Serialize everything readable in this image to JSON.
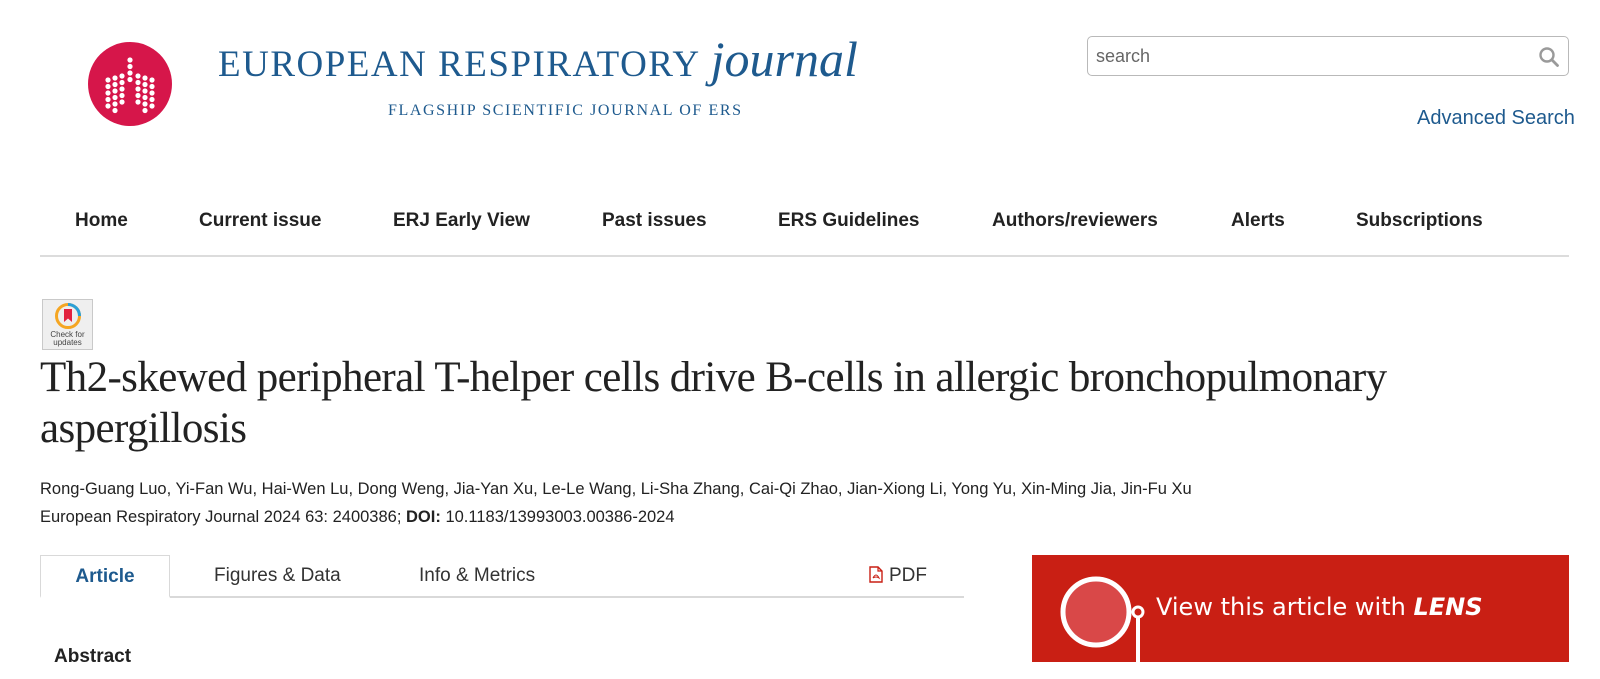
{
  "header": {
    "brand_main": "EUROPEAN RESPIRATORY",
    "brand_italic": "journal",
    "tagline": "FLAGSHIP SCIENTIFIC JOURNAL OF ERS",
    "logo_color": "#d6164a",
    "brand_color": "#1e5a8e",
    "search": {
      "placeholder": "search",
      "value": ""
    },
    "advanced_search": "Advanced Search"
  },
  "nav": {
    "items": [
      {
        "label": "Home"
      },
      {
        "label": "Current issue"
      },
      {
        "label": "ERJ Early View"
      },
      {
        "label": "Past issues"
      },
      {
        "label": "ERS Guidelines"
      },
      {
        "label": "Authors/reviewers"
      },
      {
        "label": "Alerts"
      },
      {
        "label": "Subscriptions"
      }
    ]
  },
  "article": {
    "check_updates": "Check for\nupdates",
    "title": "Th2-skewed peripheral T-helper cells drive B-cells in allergic bronchopulmonary aspergillosis",
    "authors": "Rong-Guang Luo, Yi-Fan Wu, Hai-Wen Lu, Dong Weng, Jia-Yan Xu, Le-Le Wang, Li-Sha Zhang, Cai-Qi Zhao, Jian-Xiong Li, Yong Yu, Xin-Ming Jia, Jin-Fu Xu",
    "citation_prefix": "European Respiratory Journal 2024 63: 2400386;",
    "doi_label": "DOI:",
    "doi": "10.1183/13993003.00386-2024"
  },
  "tabs": {
    "items": [
      {
        "label": "Article",
        "active": true
      },
      {
        "label": "Figures & Data",
        "active": false
      },
      {
        "label": "Info & Metrics",
        "active": false
      }
    ],
    "pdf_label": "PDF"
  },
  "abstract_heading": "Abstract",
  "lens_banner": {
    "text": "View this article with",
    "strong": "LENS",
    "bg_color": "#c91f14"
  }
}
